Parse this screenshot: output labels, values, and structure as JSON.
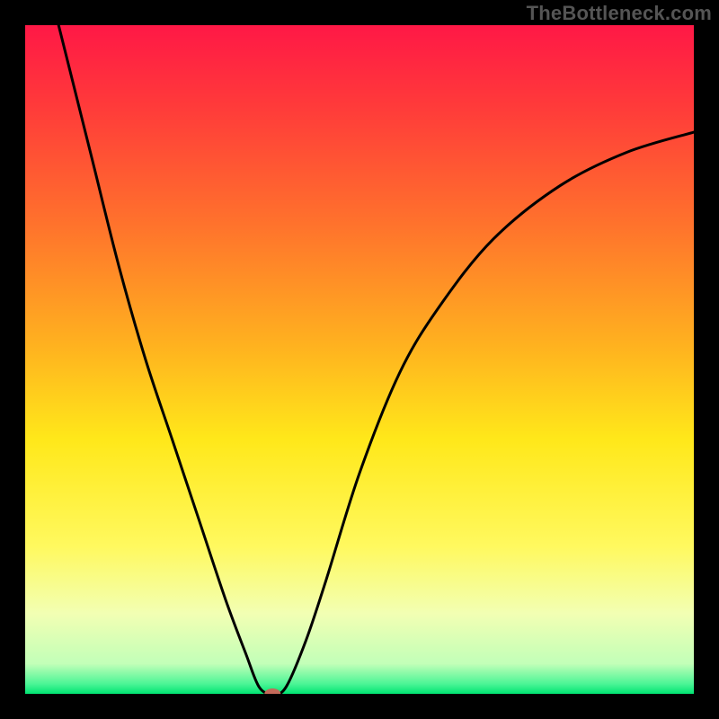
{
  "watermark": "TheBottleneck.com",
  "chart_data": {
    "type": "line",
    "title": "",
    "xlabel": "",
    "ylabel": "",
    "xlim": [
      0,
      100
    ],
    "ylim": [
      0,
      100
    ],
    "grid": false,
    "background_gradient": {
      "stops": [
        {
          "offset": 0.0,
          "color": "#ff1846"
        },
        {
          "offset": 0.12,
          "color": "#ff3a3a"
        },
        {
          "offset": 0.3,
          "color": "#ff732c"
        },
        {
          "offset": 0.48,
          "color": "#ffb21f"
        },
        {
          "offset": 0.62,
          "color": "#ffe81a"
        },
        {
          "offset": 0.78,
          "color": "#fff95f"
        },
        {
          "offset": 0.88,
          "color": "#f2ffb3"
        },
        {
          "offset": 0.955,
          "color": "#c2ffb8"
        },
        {
          "offset": 0.985,
          "color": "#4cf596"
        },
        {
          "offset": 1.0,
          "color": "#00e472"
        }
      ]
    },
    "series": [
      {
        "name": "bottleneck-curve",
        "color": "#000000",
        "width": 3,
        "points": [
          {
            "x": 5,
            "y": 100
          },
          {
            "x": 7,
            "y": 92
          },
          {
            "x": 10,
            "y": 80
          },
          {
            "x": 14,
            "y": 64
          },
          {
            "x": 18,
            "y": 50
          },
          {
            "x": 22,
            "y": 38
          },
          {
            "x": 26,
            "y": 26
          },
          {
            "x": 30,
            "y": 14
          },
          {
            "x": 33,
            "y": 6
          },
          {
            "x": 35,
            "y": 1
          },
          {
            "x": 37,
            "y": 0
          },
          {
            "x": 39,
            "y": 1
          },
          {
            "x": 42,
            "y": 8
          },
          {
            "x": 45,
            "y": 17
          },
          {
            "x": 50,
            "y": 33
          },
          {
            "x": 56,
            "y": 48
          },
          {
            "x": 62,
            "y": 58
          },
          {
            "x": 70,
            "y": 68
          },
          {
            "x": 80,
            "y": 76
          },
          {
            "x": 90,
            "y": 81
          },
          {
            "x": 100,
            "y": 84
          }
        ]
      }
    ],
    "marker": {
      "x": 37,
      "y": 0,
      "color": "#c46a5a",
      "rx": 9,
      "ry": 6
    }
  }
}
